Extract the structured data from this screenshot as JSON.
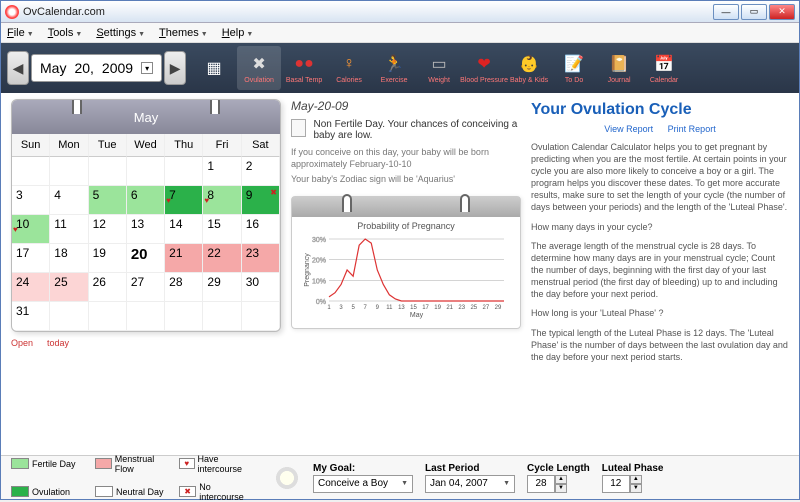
{
  "window": {
    "title": "OvCalendar.com"
  },
  "menu": [
    "File",
    "Tools",
    "Settings",
    "Themes",
    "Help"
  ],
  "date_display": {
    "month": "May",
    "day": "20,",
    "year": "2009"
  },
  "toolbar": [
    {
      "name": "calendar-mini-icon",
      "label": ""
    },
    {
      "name": "ovulation-icon",
      "label": "Ovulation",
      "glyph": "✖",
      "color": "#ddd"
    },
    {
      "name": "basal-temp-icon",
      "label": "Basal Temp",
      "glyph": "●●",
      "color": "#d33"
    },
    {
      "name": "calories-icon",
      "label": "Calories",
      "glyph": "♀",
      "color": "#f93"
    },
    {
      "name": "exercise-icon",
      "label": "Exercise",
      "glyph": "🏃",
      "color": "#c93"
    },
    {
      "name": "weight-icon",
      "label": "Weight",
      "glyph": "▭",
      "color": "#bbb"
    },
    {
      "name": "blood-pressure-icon",
      "label": "Blood Pressure",
      "glyph": "❤",
      "color": "#d22"
    },
    {
      "name": "baby-kids-icon",
      "label": "Baby & Kids",
      "glyph": "👶",
      "color": "#eca"
    },
    {
      "name": "todo-icon",
      "label": "To Do",
      "glyph": "📝",
      "color": "#fe8"
    },
    {
      "name": "journal-icon",
      "label": "Journal",
      "glyph": "📔",
      "color": "#c96"
    },
    {
      "name": "calendar-icon",
      "label": "Calendar",
      "glyph": "📅",
      "color": "#aac"
    }
  ],
  "calendar": {
    "month_label": "May",
    "dow": [
      "Sun",
      "Mon",
      "Tue",
      "Wed",
      "Thu",
      "Fri",
      "Sat"
    ],
    "cells": [
      {
        "n": "",
        "bg": ""
      },
      {
        "n": "",
        "bg": ""
      },
      {
        "n": "",
        "bg": ""
      },
      {
        "n": "",
        "bg": ""
      },
      {
        "n": "",
        "bg": ""
      },
      {
        "n": "1",
        "bg": ""
      },
      {
        "n": "2",
        "bg": ""
      },
      {
        "n": "3",
        "bg": ""
      },
      {
        "n": "4",
        "bg": ""
      },
      {
        "n": "5",
        "bg": "#9be49b"
      },
      {
        "n": "6",
        "bg": "#9be49b"
      },
      {
        "n": "7",
        "bg": "#2bb14a",
        "heart": true
      },
      {
        "n": "8",
        "bg": "#9be49b",
        "heart": true
      },
      {
        "n": "9",
        "bg": "#2bb14a",
        "x": true
      },
      {
        "n": "10",
        "bg": "#9be49b",
        "heart": true
      },
      {
        "n": "11",
        "bg": ""
      },
      {
        "n": "12",
        "bg": ""
      },
      {
        "n": "13",
        "bg": ""
      },
      {
        "n": "14",
        "bg": ""
      },
      {
        "n": "15",
        "bg": ""
      },
      {
        "n": "16",
        "bg": ""
      },
      {
        "n": "17",
        "bg": ""
      },
      {
        "n": "18",
        "bg": ""
      },
      {
        "n": "19",
        "bg": ""
      },
      {
        "n": "20",
        "bg": "",
        "sel": true
      },
      {
        "n": "21",
        "bg": "#f5a8a8"
      },
      {
        "n": "22",
        "bg": "#f5a8a8"
      },
      {
        "n": "23",
        "bg": "#f5a8a8"
      },
      {
        "n": "24",
        "bg": "#fcd5d5"
      },
      {
        "n": "25",
        "bg": "#fcd5d5"
      },
      {
        "n": "26",
        "bg": ""
      },
      {
        "n": "27",
        "bg": ""
      },
      {
        "n": "28",
        "bg": ""
      },
      {
        "n": "29",
        "bg": ""
      },
      {
        "n": "30",
        "bg": ""
      },
      {
        "n": "31",
        "bg": ""
      },
      {
        "n": "",
        "bg": ""
      },
      {
        "n": "",
        "bg": ""
      },
      {
        "n": "",
        "bg": ""
      },
      {
        "n": "",
        "bg": ""
      },
      {
        "n": "",
        "bg": ""
      },
      {
        "n": "",
        "bg": ""
      }
    ],
    "links": {
      "open": "Open",
      "today": "today"
    }
  },
  "mid": {
    "date": "May-20-09",
    "status_title": "Non Fertile Day. Your chances of conceiving a baby are low.",
    "note1": "If you conceive on this day, your baby will be born approximately February-10-10",
    "note2": "Your baby's Zodiac sign will be 'Aquarius'"
  },
  "chart_data": {
    "type": "line",
    "title": "Probability of Pregnancy",
    "xlabel": "May",
    "ylabel": "Pregnancy",
    "x": [
      1,
      2,
      3,
      4,
      5,
      6,
      7,
      8,
      9,
      10,
      11,
      12,
      13,
      14,
      15,
      16,
      17,
      18,
      19,
      20,
      21,
      22,
      23,
      24,
      25,
      26,
      27,
      28,
      29,
      30
    ],
    "values": [
      2,
      4,
      8,
      15,
      12,
      27,
      30,
      28,
      15,
      8,
      3,
      1,
      0,
      0,
      0,
      0,
      0,
      0,
      0,
      0,
      0,
      0,
      0,
      0,
      0,
      0,
      0,
      0,
      0,
      0
    ],
    "ylim": [
      0,
      30
    ],
    "yticks": [
      "0%",
      "10%",
      "20%",
      "30%"
    ]
  },
  "right": {
    "heading": "Your Ovulation Cycle",
    "view": "View Report",
    "print": "Print Report",
    "p1": "Ovulation Calendar Calculator helps you to get pregnant by predicting when you are the most fertile. At certain points in your cycle you are also more likely to conceive a boy or a girl. The program helps you discover these dates. To get more accurate results, make sure to set the length of your cycle (the number of days between your periods) and the length of the 'Luteal Phase'.",
    "q1": "How many days in your cycle?",
    "p2": "The average length of the menstrual cycle is 28 days. To determine how many days are in your menstrual cycle; Count the number of days, beginning with the first day of your last menstrual period (the first day of bleeding) up to and including the day before your next period.",
    "q2": "How long is your 'Luteal Phase' ?",
    "p3": "The typical length of the Luteal Phase is 12 days. The 'Luteal Phase' is the number of days between the last ovulation day and the day before your next period starts."
  },
  "legend": [
    {
      "label": "Fertile Day",
      "color": "#9be49b"
    },
    {
      "label": "Menstrual Flow",
      "color": "#f5a8a8"
    },
    {
      "label": "Have intercourse",
      "color": "#fff",
      "sym": "♥"
    },
    {
      "label": "Ovulation",
      "color": "#2bb14a"
    },
    {
      "label": "Neutral Day",
      "color": "#fff"
    },
    {
      "label": "No intercourse",
      "color": "#fff",
      "sym": "✖"
    }
  ],
  "footer": {
    "goal_label": "My Goal:",
    "goal_value": "Conceive a Boy",
    "last_period_label": "Last Period",
    "last_period_value": "Jan 04, 2007",
    "cycle_label": "Cycle Length",
    "cycle_value": "28",
    "luteal_label": "Luteal Phase",
    "luteal_value": "12"
  }
}
